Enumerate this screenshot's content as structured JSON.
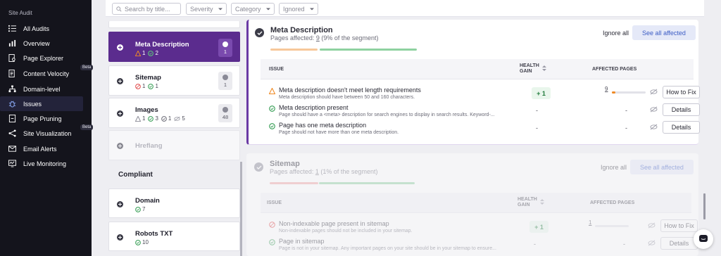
{
  "nav": {
    "section": "Site Audit",
    "items": [
      {
        "label": "All Audits",
        "icon": "list-icon"
      },
      {
        "label": "Overview",
        "icon": "bar-chart-icon"
      },
      {
        "label": "Page Explorer",
        "icon": "page-search-icon"
      },
      {
        "label": "Content Velocity",
        "icon": "document-speed-icon",
        "badge": "Beta"
      },
      {
        "label": "Domain-level",
        "icon": "hierarchy-icon"
      },
      {
        "label": "Issues",
        "icon": "bug-icon",
        "active": true
      },
      {
        "label": "Page Pruning",
        "icon": "page-prune-icon"
      },
      {
        "label": "Site Visualization",
        "icon": "network-icon",
        "badge": "Beta"
      },
      {
        "label": "Email Alerts",
        "icon": "mail-icon"
      },
      {
        "label": "Live Monitoring",
        "icon": "monitor-icon"
      }
    ]
  },
  "filters": {
    "search_placeholder": "Search by title...",
    "severity": "Severity",
    "category": "Category",
    "ignored": "Ignored"
  },
  "issue_groups": [
    {
      "title": "Meta Description",
      "warn": "1",
      "ok": "2",
      "badge": "1",
      "selected": true
    },
    {
      "title": "Sitemap",
      "error": "1",
      "ok": "1",
      "badge": "1"
    },
    {
      "title": "Images",
      "warn": "1",
      "ok": "3",
      "ok2": "1",
      "ignored": "5",
      "badge": "48"
    },
    {
      "title": "Hreflang"
    }
  ],
  "compliant": {
    "label": "Compliant",
    "items": [
      {
        "title": "Domain",
        "ok": "7"
      },
      {
        "title": "Robots TXT",
        "ok": "10"
      }
    ]
  },
  "panels": {
    "meta": {
      "title": "Meta Description",
      "pages_prefix": "Pages affected: ",
      "pages_count": "9",
      "pages_suffix": " (9% of the segment)",
      "ignore_all": "Ignore all",
      "see_all": "See all affected",
      "col_issue": "ISSUE",
      "col_health_1": "HEALTH",
      "col_health_2": "GAIN",
      "col_affected": "AFFECTED PAGES",
      "rows": [
        {
          "title": "Meta description doesn't meet length requirements",
          "desc": "Meta description should have between 50 and 160 characters.",
          "gain": "+ 1",
          "affected": "9",
          "affected_fraction": 0.1,
          "button": "How to Fix",
          "severity": "warning"
        },
        {
          "title": "Meta description present",
          "desc": "Page should have a <meta> description for search engines to display in search results. Keyword-...",
          "gain": "-",
          "affected": "-",
          "button": "Details",
          "severity": "ok"
        },
        {
          "title": "Page has one meta description",
          "desc": "Page should not have more than one meta description.",
          "gain": "-",
          "affected": "-",
          "button": "Details",
          "severity": "ok"
        }
      ]
    },
    "sitemap": {
      "title": "Sitemap",
      "pages_prefix": "Pages affected: ",
      "pages_count": "1",
      "pages_suffix": " (1% of the segment)",
      "ignore_all": "Ignore all",
      "see_all": "See all affected",
      "col_issue": "ISSUE",
      "col_health_1": "HEALTH",
      "col_health_2": "GAIN",
      "col_affected": "AFFECTED PAGES",
      "rows": [
        {
          "title": "Non-indexable page present in sitemap",
          "desc": "Non-indexable pages should not be included in your sitemap.",
          "gain": "+ 1",
          "affected": "1",
          "button": "How to Fix",
          "severity": "error"
        },
        {
          "title": "Page in sitemap",
          "desc": "Page is not in your sitemap. Any important pages on your site should be in your sitemap to ensure...",
          "gain": "-",
          "affected": "-",
          "button": "Details",
          "severity": "ok"
        }
      ]
    }
  },
  "colors": {
    "accent": "#5b2c8e",
    "warning": "#f08a24",
    "ok": "#2e9a4e",
    "error": "#e04848",
    "link": "#3b5bc4"
  }
}
